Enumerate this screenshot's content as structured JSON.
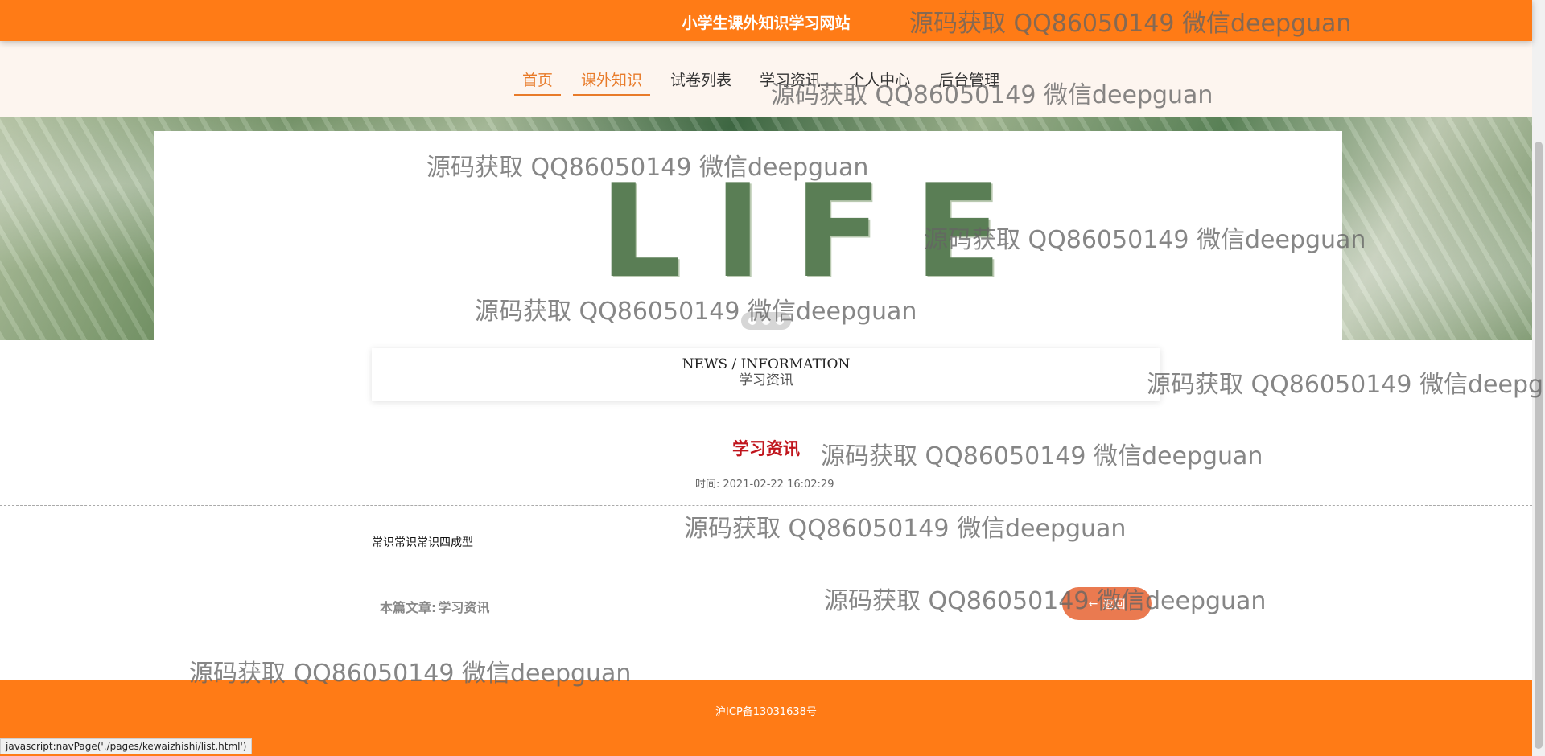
{
  "header": {
    "site_title": "小学生课外知识学习网站"
  },
  "nav": {
    "items": [
      {
        "label": "首页",
        "active": true
      },
      {
        "label": "课外知识",
        "active": true
      },
      {
        "label": "试卷列表",
        "active": false
      },
      {
        "label": "学习资讯",
        "active": false
      },
      {
        "label": "个人中心",
        "active": false
      },
      {
        "label": "后台管理",
        "active": false
      }
    ]
  },
  "banner": {
    "word": "LIFE",
    "slide_count": 3,
    "active_slide": 1
  },
  "section": {
    "title_en": "NEWS / INFORMATION",
    "title_zh": "学习资讯"
  },
  "article": {
    "title": "学习资讯",
    "time_label": "时间:",
    "time_value": "2021-02-22 16:02:29",
    "content": "常识常识常识四成型",
    "source_label": "本篇文章:",
    "source_value": "学习资讯",
    "back_label": "返回",
    "back_icon": "arrow-left-icon"
  },
  "footer": {
    "icp": "沪ICP备13031638号"
  },
  "status_bar": {
    "url": "javascript:navPage('./pages/kewaizhishi/list.html')"
  },
  "watermark": {
    "text": "源码获取 QQ86050149 微信deepguan",
    "clipped_text": "源码获取 QQ86050149 微信deepgu"
  },
  "colors": {
    "brand_orange": "#ff7b16",
    "nav_active": "#e87b2a",
    "title_red": "#c0141c",
    "back_button": "#ea7a50"
  }
}
